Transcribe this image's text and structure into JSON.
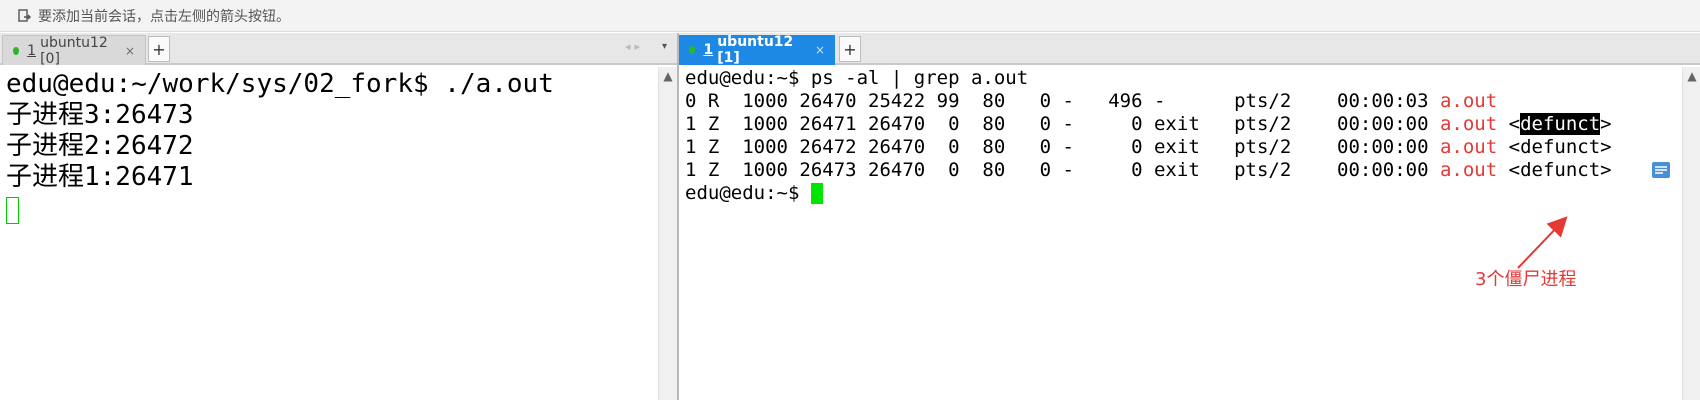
{
  "hint": {
    "text": "要添加当前会话，点击左侧的箭头按钮。"
  },
  "left_pane": {
    "tab": {
      "number": "1",
      "label": "ubuntu12 [0]",
      "close": "×"
    },
    "plus": "+",
    "lines": [
      "edu@edu:~/work/sys/02_fork$ ./a.out",
      "子进程3:26473",
      "子进程2:26472",
      "子进程1:26471"
    ]
  },
  "right_pane": {
    "tab": {
      "number": "1",
      "label": "ubuntu12 [1]",
      "close": "×"
    },
    "plus": "+",
    "command_line": "edu@edu:~$ ps -al | grep a.out",
    "rows": [
      {
        "prefix": "0 R  1000 26470 25422 99  80   0 -   496 -      pts/2    00:00:03 ",
        "name": "a.out",
        "suffix": ""
      },
      {
        "prefix": "1 Z  1000 26471 26470  0  80   0 -     0 exit   pts/2    00:00:00 ",
        "name": "a.out",
        "suffix": " <defunct>"
      },
      {
        "prefix": "1 Z  1000 26472 26470  0  80   0 -     0 exit   pts/2    00:00:00 ",
        "name": "a.out",
        "suffix": " <defunct>"
      },
      {
        "prefix": "1 Z  1000 26473 26470  0  80   0 -     0 exit   pts/2    00:00:00 ",
        "name": "a.out",
        "suffix": " <defunct>"
      }
    ],
    "highlight_word": "defunct",
    "prompt": "edu@edu:~$ "
  },
  "annotation": {
    "text": "3个僵尸进程",
    "color": "#e53935"
  },
  "colors": {
    "accent": "#1e88e5",
    "cursor": "#00e600",
    "process_name": "#e53935"
  }
}
